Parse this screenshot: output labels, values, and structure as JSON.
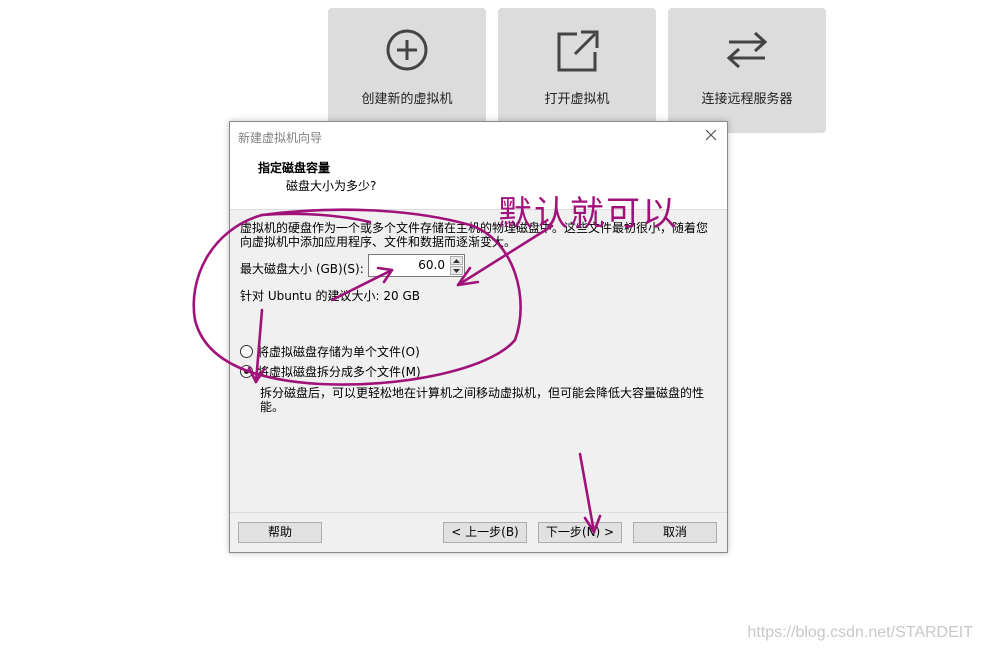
{
  "tiles": [
    {
      "label": "创建新的虚拟机",
      "icon": "plus-circle-icon"
    },
    {
      "label": "打开虚拟机",
      "icon": "open-external-icon"
    },
    {
      "label": "连接远程服务器",
      "icon": "swap-arrows-icon"
    }
  ],
  "dialog": {
    "title": "新建虚拟机向导",
    "header_title": "指定磁盘容量",
    "header_subtitle": "磁盘大小为多少?",
    "description": "虚拟机的硬盘作为一个或多个文件存储在主机的物理磁盘中。这些文件最初很小，随着您向虚拟机中添加应用程序、文件和数据而逐渐变大。",
    "max_size_label": "最大磁盘大小 (GB)(S):",
    "max_size_value": "60.0",
    "recommended": "针对 Ubuntu 的建议大小: 20 GB",
    "radio_single": "将虚拟磁盘存储为单个文件(O)",
    "radio_split": "将虚拟磁盘拆分成多个文件(M)",
    "split_description": "拆分磁盘后，可以更轻松地在计算机之间移动虚拟机，但可能会降低大容量磁盘的性能。",
    "selected_option": "split",
    "buttons": {
      "help": "帮助",
      "back": "< 上一步(B)",
      "next": "下一步(N) >",
      "cancel": "取消"
    }
  },
  "annotation": {
    "text": "默认就可以",
    "color": "#a0127a"
  },
  "watermark": "https://blog.csdn.net/STARDEIT"
}
